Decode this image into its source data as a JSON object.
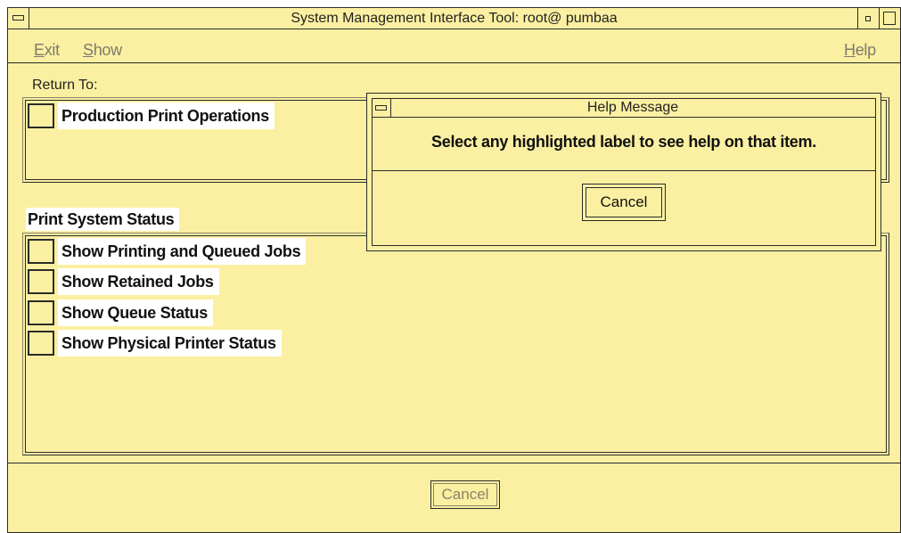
{
  "window": {
    "title": "System Management Interface Tool:  root@ pumbaa"
  },
  "menubar": {
    "exit": {
      "mnemonic": "E",
      "rest": "xit"
    },
    "show": {
      "mnemonic": "S",
      "rest": "how"
    },
    "help": {
      "mnemonic": "H",
      "rest": "elp"
    }
  },
  "return_to": {
    "label": "Return To:",
    "items": [
      {
        "label": "Production Print Operations"
      }
    ]
  },
  "print_system_status": {
    "title": "Print System Status",
    "items": [
      {
        "label": "Show Printing and Queued Jobs"
      },
      {
        "label": "Show Retained Jobs"
      },
      {
        "label": "Show Queue Status"
      },
      {
        "label": "Show Physical Printer Status"
      }
    ]
  },
  "footer": {
    "cancel_label": "Cancel"
  },
  "help_dialog": {
    "title": "Help Message",
    "message": "Select any highlighted label to see help on that item.",
    "cancel_label": "Cancel"
  },
  "colors": {
    "window_bg": "#fbf0a2",
    "border": "#2b2b2b",
    "disabled_text": "#8a8266"
  }
}
